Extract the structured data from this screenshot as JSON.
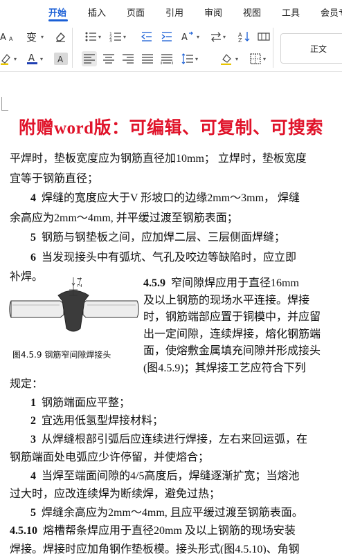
{
  "ribbon": {
    "tabs": [
      "开始",
      "插入",
      "页面",
      "引用",
      "审阅",
      "视图",
      "工具",
      "会员专"
    ],
    "active_tab": "开始",
    "font_color": "#1f3fb3",
    "accent": "#1a5fd6",
    "style_gallery": {
      "label": "正文"
    }
  },
  "document": {
    "banner": "附赠word版：可编辑、可复制、可搜索",
    "banner_color": "#e0132a",
    "lines_top": [
      {
        "num": "",
        "text": "平焊时，垫板宽度应为钢筋直径加10mm；  立焊时，垫板宽度"
      },
      {
        "num": "",
        "text": "宜等于钢筋直径；"
      },
      {
        "num": "4",
        "text": "焊缝的宽度应大于V 形坡口的边缘2mm～3mm，     焊缝"
      },
      {
        "num": "",
        "text": "余高应为2mm～4mm, 并平缓过渡至钢筋表面；"
      },
      {
        "num": "5",
        "text": "钢筋与钢垫板之间，应加焊二层、三层侧面焊缝；"
      },
      {
        "num": "6",
        "text": "当发现接头中有弧坑、气孔及咬边等缺陷时，应立即"
      },
      {
        "num": "",
        "text": "补焊。"
      }
    ],
    "figure": {
      "dimension_label": "2~4",
      "caption": "图4.5.9  钢筋窄间隙焊接头"
    },
    "side_paragraph": [
      {
        "num": "4.5.9",
        "text": "窄间隙焊应用于直径16mm"
      },
      {
        "num": "",
        "text": "及以上钢筋的现场水平连接。焊接"
      },
      {
        "num": "",
        "text": "时，钢筋端部应置于铜模中，并应留"
      },
      {
        "num": "",
        "text": "出一定间隙，连续焊接，熔化钢筋端"
      },
      {
        "num": "",
        "text": "面，使熔敷金属填充间隙并形成接头"
      },
      {
        "num": "",
        "text": "(图4.5.9)；其焊接工艺应符合下列"
      }
    ],
    "lines_bottom": [
      {
        "num": "",
        "text": "规定："
      },
      {
        "num": "1",
        "text": "钢筋端面应平整；"
      },
      {
        "num": "2",
        "text": "宜选用低氢型焊接材料；"
      },
      {
        "num": "3",
        "text": "从焊缝根部引弧后应连续进行焊接，左右来回运弧，在"
      },
      {
        "num": "",
        "text": "钢筋端面处电弧应少许停留，并使熔合；"
      },
      {
        "num": "4",
        "text": "当焊至端面间隙的4/5高度后，焊缝逐渐扩宽；当熔池"
      },
      {
        "num": "",
        "text": "过大时，应改连续焊为断续焊，避免过热；"
      },
      {
        "num": "5",
        "text": "焊缝余高应为2mm～4mm,      且应平缓过渡至钢筋表面。"
      },
      {
        "num": "4.5.10",
        "text": "熔槽帮条焊应用于直径20mm 及以上钢筋的现场安装"
      },
      {
        "num": "",
        "text": "焊接。焊接时应加角钢作垫板模。接头形式(图4.5.10)、角钢"
      }
    ]
  }
}
